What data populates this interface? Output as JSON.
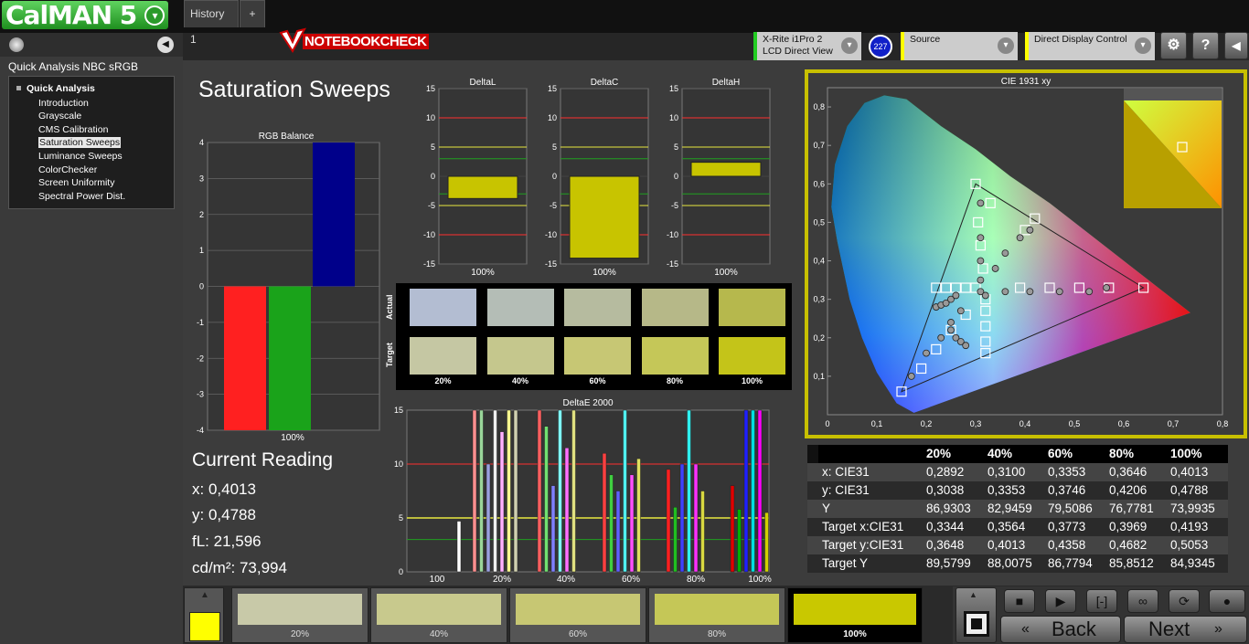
{
  "app": {
    "logo_text": "CalMAN 5",
    "logo_dropdown": "▾"
  },
  "sidebar": {
    "title": "Quick Analysis NBC sRGB",
    "tree_root": "Quick Analysis",
    "items": [
      "Introduction",
      "Grayscale",
      "CMS Calibration",
      "Saturation Sweeps",
      "Luminance Sweeps",
      "ColorChecker",
      "Screen Uniformity",
      "Spectral Power Dist."
    ],
    "selected_index": 3
  },
  "tabs": {
    "history": "History 1",
    "add": "+"
  },
  "watermark": "NOTEBOOKCHECK",
  "header": {
    "meter_line1": "X-Rite i1Pro 2",
    "meter_line2": "LCD Direct View",
    "meter_badge": "227",
    "source_label": "Source",
    "display_label": "Direct Display Control",
    "gear_icon": "⚙",
    "help_icon": "?",
    "collapse_icon": "◀"
  },
  "page_title": "Saturation Sweeps",
  "rgb_balance": {
    "title": "RGB Balance",
    "xlabel": "100%",
    "ylim": [
      -4,
      4
    ],
    "ticks": [
      "4",
      "3",
      "2",
      "1",
      "0",
      "-1",
      "-2",
      "-3",
      "-4"
    ],
    "bars": [
      {
        "name": "R",
        "value": -4,
        "color": "#ff2020"
      },
      {
        "name": "G",
        "value": -4,
        "color": "#1aa31a"
      },
      {
        "name": "B",
        "value": 4,
        "color": "#00008a"
      }
    ]
  },
  "delta_charts": [
    {
      "title": "DeltaL",
      "value": -3.8,
      "xlabel": "100%"
    },
    {
      "title": "DeltaC",
      "value": -14,
      "xlabel": "100%"
    },
    {
      "title": "DeltaH",
      "value": 2.4,
      "xlabel": "100%"
    }
  ],
  "delta_ticks": [
    "15",
    "10",
    "5",
    "0",
    "-5",
    "-10",
    "-15"
  ],
  "swatches": {
    "actual_label": "Actual",
    "target_label": "Target",
    "labels": [
      "20%",
      "40%",
      "60%",
      "80%",
      "100%"
    ],
    "actual": [
      "#b3bdd2",
      "#b4bdb6",
      "#b6bb9f",
      "#b6b888",
      "#b6b84d"
    ],
    "target": [
      "#c5c7a3",
      "#c5c78d",
      "#c7c774",
      "#c5c758",
      "#c4c419"
    ]
  },
  "deltae_chart": {
    "title": "DeltaE 2000",
    "ticks": [
      "15",
      "10",
      "5",
      "0"
    ],
    "xlabels": [
      "100",
      "20%",
      "40%",
      "60%",
      "80%",
      "100%"
    ],
    "ylim": [
      0,
      15
    ]
  },
  "current_reading": {
    "title": "Current Reading",
    "x": "x: 0,4013",
    "y": "y: 0,4788",
    "fl": "fL: 21,596",
    "cdm2": "cd/m²: 73,994"
  },
  "cie": {
    "title": "CIE 1931 xy",
    "yticks": [
      "0,8",
      "0,7",
      "0,6",
      "0,5",
      "0,4",
      "0,3",
      "0,2",
      "0,1"
    ],
    "xticks": [
      "0",
      "0,1",
      "0,2",
      "0,3",
      "0,4",
      "0,5",
      "0,6",
      "0,7",
      "0,8"
    ]
  },
  "table": {
    "headers": [
      "20%",
      "40%",
      "60%",
      "80%",
      "100%"
    ],
    "rows": [
      {
        "label": "x: CIE31",
        "values": [
          "0,2892",
          "0,3100",
          "0,3353",
          "0,3646",
          "0,4013"
        ]
      },
      {
        "label": "y: CIE31",
        "values": [
          "0,3038",
          "0,3353",
          "0,3746",
          "0,4206",
          "0,4788"
        ]
      },
      {
        "label": "Y",
        "values": [
          "86,9303",
          "82,9459",
          "79,5086",
          "76,7781",
          "73,9935"
        ]
      },
      {
        "label": "Target x:CIE31",
        "values": [
          "0,3344",
          "0,3564",
          "0,3773",
          "0,3969",
          "0,4193"
        ]
      },
      {
        "label": "Target y:CIE31",
        "values": [
          "0,3648",
          "0,4013",
          "0,4358",
          "0,4682",
          "0,5053"
        ]
      },
      {
        "label": "Target Y",
        "values": [
          "89,5799",
          "88,0075",
          "86,7794",
          "85,8512",
          "84,9345"
        ]
      }
    ]
  },
  "bottom": {
    "swatch_labels": [
      "20%",
      "40%",
      "60%",
      "80%",
      "100%"
    ],
    "swatch_colors": [
      "#c8c9a8",
      "#c8c98d",
      "#c7c773",
      "#c5c757",
      "#c9c800"
    ],
    "current_color": "#ffff00",
    "back_label": "Back",
    "next_label": "Next"
  },
  "colors": {
    "accent_yellow": "#ffff00",
    "panel": "#3c3c3c"
  }
}
